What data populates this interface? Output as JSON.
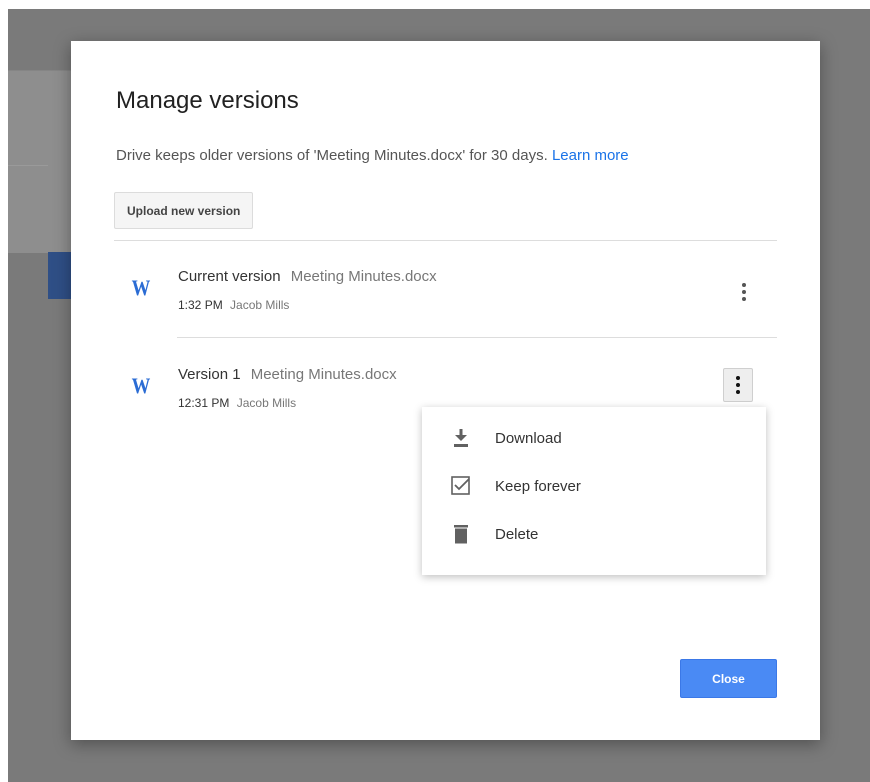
{
  "dialog": {
    "title": "Manage versions",
    "description": "Drive keeps older versions of 'Meeting Minutes.docx' for 30 days.",
    "learn_more": "Learn more",
    "upload_label": "Upload new version",
    "close_label": "Close"
  },
  "versions": [
    {
      "icon": "word-doc-icon",
      "icon_glyph": "W",
      "label": "Current version",
      "filename": "Meeting Minutes.docx",
      "time": "1:32 PM",
      "user": "Jacob Mills"
    },
    {
      "icon": "word-doc-icon",
      "icon_glyph": "W",
      "label": "Version 1",
      "filename": "Meeting Minutes.docx",
      "time": "12:31 PM",
      "user": "Jacob Mills"
    }
  ],
  "menu": {
    "items": [
      {
        "label": "Download",
        "icon": "download-icon"
      },
      {
        "label": "Keep forever",
        "icon": "checkbox-checked-icon"
      },
      {
        "label": "Delete",
        "icon": "trash-icon"
      }
    ]
  },
  "colors": {
    "accent": "#4a8af4",
    "link": "#1a73e8",
    "word_icon": "#2b6cd4",
    "backdrop": "#7a7a7a"
  }
}
